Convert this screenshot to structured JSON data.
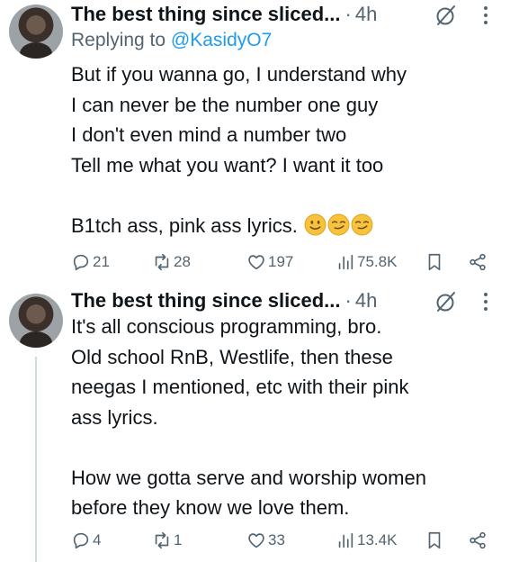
{
  "tweets": [
    {
      "author_name": "The best thing since sliced...",
      "separator": "·",
      "time": "4h",
      "reply_prefix": "Replying to",
      "reply_handle": "@KasidyO7",
      "lines": [
        "But if you wanna go, I understand why",
        "I can never be the number one guy",
        "I don't even mind a number two",
        "Tell me what you want? I want it too",
        "",
        "B1tch ass, pink ass lyrics."
      ],
      "emojis": [
        "slightly-smiling-face-emoji",
        "smirking-face-emoji",
        "smirking-face-emoji"
      ],
      "stats": {
        "replies": "21",
        "reposts": "28",
        "likes": "197",
        "views": "75.8K"
      }
    },
    {
      "author_name": "The best thing since sliced...",
      "separator": "·",
      "time": "4h",
      "lines": [
        "It's all conscious programming, bro.",
        "Old school RnB, Westlife, then these",
        "neegas I mentioned, etc with their pink",
        "ass lyrics.",
        "",
        "How we gotta serve and worship women",
        "before they know we love them."
      ],
      "stats": {
        "replies": "4",
        "reposts": "1",
        "likes": "33",
        "views": "13.4K"
      }
    }
  ],
  "icons": {
    "reply": "reply-icon",
    "repost": "repost-icon",
    "like": "like-icon",
    "views": "views-icon",
    "bookmark": "bookmark-icon",
    "share": "share-icon",
    "grok": "grok-icon",
    "more": "more-icon"
  },
  "colors": {
    "text": "#0f1419",
    "secondary": "#536471",
    "link": "#1d9bf0",
    "thread_line": "#cfd9de",
    "emoji_yellow": "#f7c33c"
  }
}
